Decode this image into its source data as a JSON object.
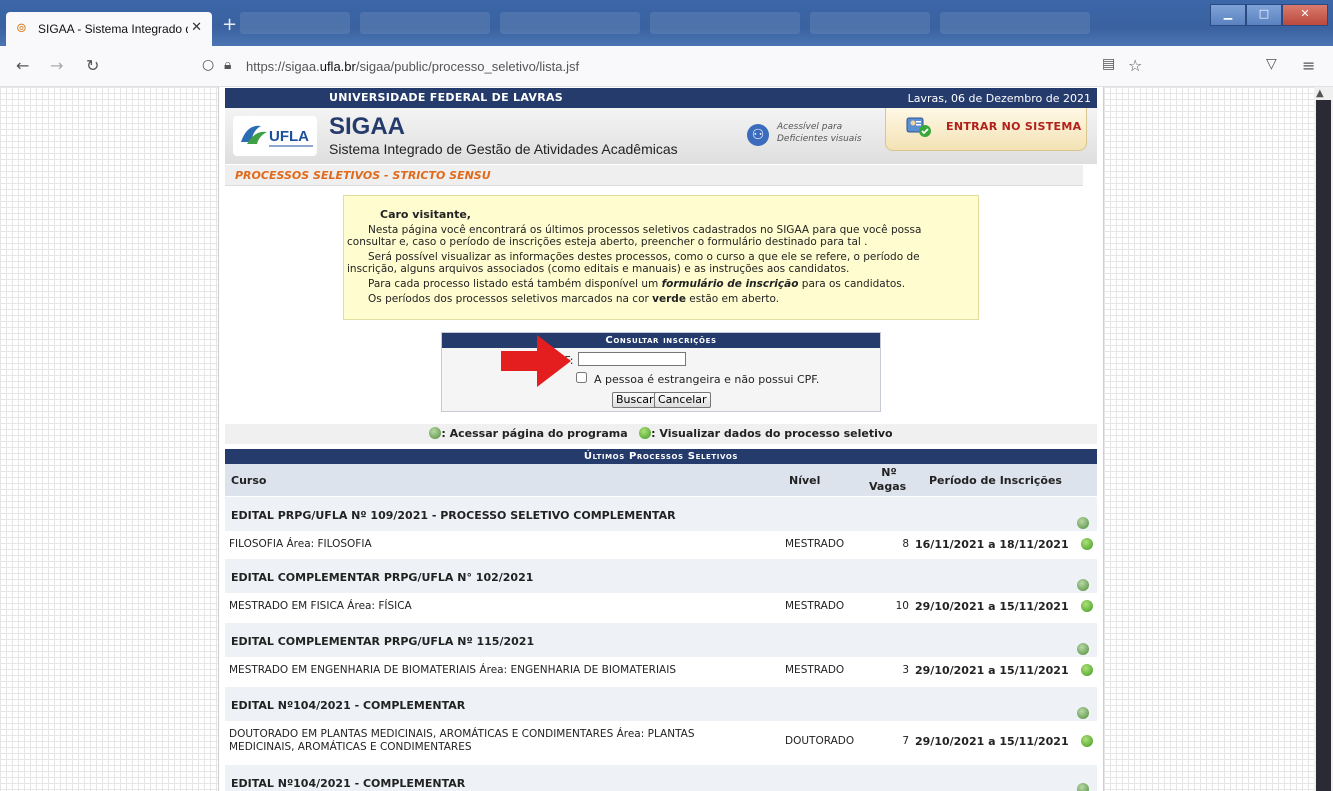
{
  "browser": {
    "tab_title": "SIGAA - Sistema Integrado de G",
    "new_tab": "+",
    "url_host_prefix": "https://sigaa.",
    "url_host_bold": "ufla.br",
    "url_path": "/sigaa/public/processo_seletivo/lista.jsf"
  },
  "site": {
    "university": "UNIVERSIDADE FEDERAL DE LAVRAS",
    "date": "Lavras, 06 de Dezembro de 2021",
    "logo_text": "UFLA",
    "app_name": "SIGAA",
    "app_subtitle": "Sistema Integrado de Gestão de Atividades Acadêmicas",
    "accessible_line1": "Acessível para",
    "accessible_line2": "Deficientes visuais",
    "login_label": "ENTRAR NO SISTEMA",
    "breadcrumb": "PROCESSOS SELETIVOS - STRICTO SENSU"
  },
  "notice": {
    "greeting": "Caro visitante,",
    "l1": "Nesta página você encontrará os últimos processos seletivos cadastrados no SIGAA para que você possa",
    "l2": "consultar e, caso o período de inscrições esteja aberto, preencher o formulário destinado para tal .",
    "l3": "Será possível visualizar as informações destes processos, como o curso a que ele se refere, o período de",
    "l4": "inscrição, alguns arquivos associados (como editais e manuais) e as instruções aos candidatos.",
    "l5_pre": "Para cada processo listado está também disponível um ",
    "l5_em": "formulário de inscrição",
    "l5_post": " para os candidatos.",
    "l6_pre": "Os períodos dos processos seletivos marcados na cor ",
    "l6_em": "verde",
    "l6_post": " estão em aberto."
  },
  "consult": {
    "title": "Consultar inscrições",
    "cpf_label": "CPF:",
    "cpf_value": "",
    "foreign_label": "A pessoa é estrangeira e não possui CPF.",
    "search_button": "Buscar",
    "cancel_button": "Cancelar"
  },
  "legend": {
    "program": ": Acessar página do programa",
    "view": ": Visualizar dados do processo seletivo"
  },
  "list": {
    "title": "Últimos Processos Seletivos",
    "col_curso": "Curso",
    "col_nivel": "Nível",
    "col_vagas_1": "Nº",
    "col_vagas_2": "Vagas",
    "col_periodo": "Período de Inscrições",
    "groups": [
      {
        "title": "EDITAL PRPG/UFLA Nº 109/2021 - PROCESSO SELETIVO COMPLEMENTAR",
        "curso": "FILOSOFIA  Área: FILOSOFIA",
        "nivel": "MESTRADO",
        "vagas": "8",
        "periodo": "16/11/2021 a 18/11/2021"
      },
      {
        "title": "EDITAL COMPLEMENTAR PRPG/UFLA N° 102/2021",
        "curso": "MESTRADO EM FISICA  Área: FÍSICA",
        "nivel": "MESTRADO",
        "vagas": "10",
        "periodo": "29/10/2021 a 15/11/2021"
      },
      {
        "title": "EDITAL COMPLEMENTAR PRPG/UFLA Nº 115/2021",
        "curso": "MESTRADO EM ENGENHARIA DE BIOMATERIAIS  Área: ENGENHARIA DE BIOMATERIAIS",
        "nivel": "MESTRADO",
        "vagas": "3",
        "periodo": "29/10/2021 a 15/11/2021"
      },
      {
        "title": "EDITAL Nº104/2021 - COMPLEMENTAR",
        "curso": "DOUTORADO EM PLANTAS MEDICINAIS, AROMÁTICAS E CONDIMENTARES  Área: PLANTAS",
        "curso2": "MEDICINAIS, AROMÁTICAS E CONDIMENTARES",
        "nivel": "DOUTORADO",
        "vagas": "7",
        "periodo": "29/10/2021 a 15/11/2021"
      },
      {
        "title": "EDITAL Nº104/2021 - COMPLEMENTAR"
      }
    ]
  },
  "colors": {
    "navy": "#253b6c",
    "breadcrumb": "#e06a1a",
    "login": "#b2201c",
    "notice_bg": "#fffdd0"
  }
}
